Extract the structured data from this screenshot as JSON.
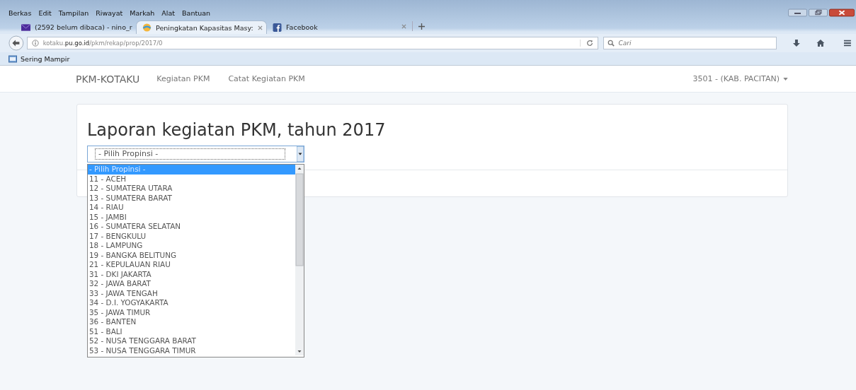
{
  "menu_bar": [
    "Berkas",
    "Edit",
    "Tampilan",
    "Riwayat",
    "Markah",
    "Alat",
    "Bantuan"
  ],
  "tabs": [
    {
      "label": "(2592 belum dibaca) - nino_r",
      "kind": "mail",
      "selected": false
    },
    {
      "label": "Peningkatan Kapasitas Masy:",
      "kind": "site",
      "selected": true
    },
    {
      "label": "Facebook",
      "kind": "facebook",
      "selected": false
    }
  ],
  "address_bar": {
    "url": "kotaku.**pu.go.id**/pkm/rekap/prop/2017/0"
  },
  "search": {
    "placeholder": "Cari"
  },
  "bookmarks": [
    "Sering Mampir"
  ],
  "navbar": {
    "brand": "PKM-KOTAKU",
    "links": [
      "Kegiatan PKM",
      "Catat Kegiatan PKM"
    ],
    "user": "3501 - (KAB. PACITAN)"
  },
  "page": {
    "title": "Laporan kegiatan PKM, tahun 2017",
    "select_value": "- Pilih Propinsi -",
    "options": [
      {
        "label": "- Pilih Propinsi -",
        "selected": true
      },
      {
        "label": "11 - ACEH",
        "selected": false
      },
      {
        "label": "12 - SUMATERA UTARA",
        "selected": false
      },
      {
        "label": "13 - SUMATERA BARAT",
        "selected": false
      },
      {
        "label": "14 - RIAU",
        "selected": false
      },
      {
        "label": "15 - JAMBI",
        "selected": false
      },
      {
        "label": "16 - SUMATERA SELATAN",
        "selected": false
      },
      {
        "label": "17 - BENGKULU",
        "selected": false
      },
      {
        "label": "18 - LAMPUNG",
        "selected": false
      },
      {
        "label": "19 - BANGKA BELITUNG",
        "selected": false
      },
      {
        "label": "21 - KEPULAUAN RIAU",
        "selected": false
      },
      {
        "label": "31 - DKI JAKARTA",
        "selected": false
      },
      {
        "label": "32 - JAWA BARAT",
        "selected": false
      },
      {
        "label": "33 - JAWA TENGAH",
        "selected": false
      },
      {
        "label": "34 - D.I. YOGYAKARTA",
        "selected": false
      },
      {
        "label": "35 - JAWA TIMUR",
        "selected": false
      },
      {
        "label": "36 - BANTEN",
        "selected": false
      },
      {
        "label": "51 - BALI",
        "selected": false
      },
      {
        "label": "52 - NUSA TENGGARA BARAT",
        "selected": false
      },
      {
        "label": "53 - NUSA TENGGARA TIMUR",
        "selected": false
      }
    ]
  }
}
